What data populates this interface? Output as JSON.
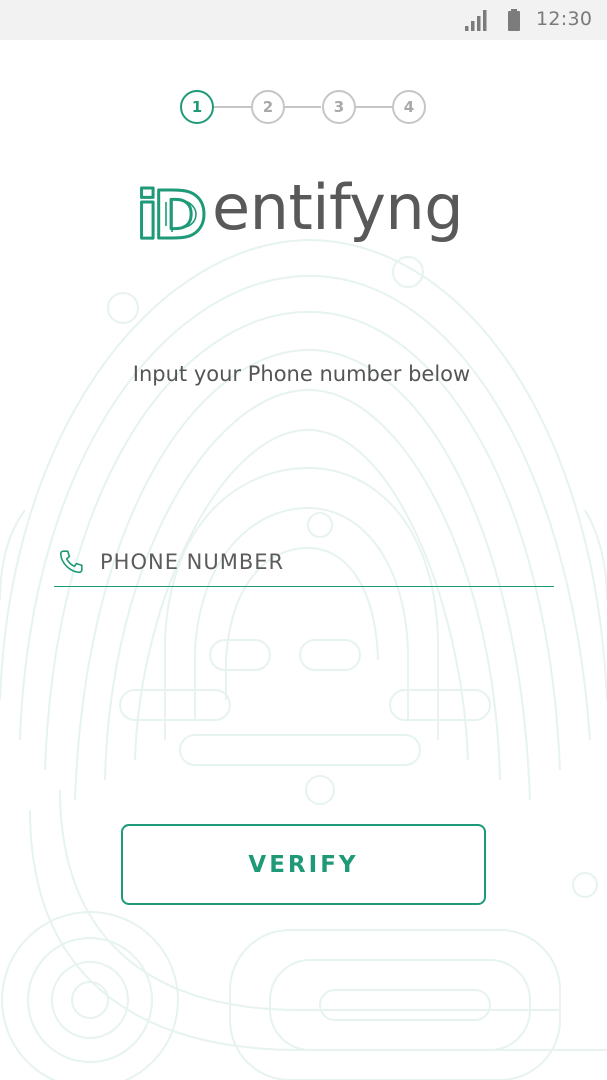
{
  "status_bar": {
    "time": "12:30",
    "signal_icon": "signal-icon",
    "battery_icon": "battery-icon"
  },
  "stepper": {
    "current_step": 1,
    "steps": [
      {
        "label": "1"
      },
      {
        "label": "2"
      },
      {
        "label": "3"
      },
      {
        "label": "4"
      }
    ]
  },
  "logo": {
    "text": "entifyng",
    "mark_text": "iD"
  },
  "instruction": "Input your Phone number below",
  "phone_field": {
    "icon": "phone-icon",
    "placeholder": "PHONE NUMBER",
    "value": ""
  },
  "verify_button": {
    "label": "VERIFY"
  },
  "colors": {
    "accent": "#1f9a78",
    "inactive": "#c6c6c6",
    "text": "#555555",
    "status_bar": "#f2f2f2"
  }
}
